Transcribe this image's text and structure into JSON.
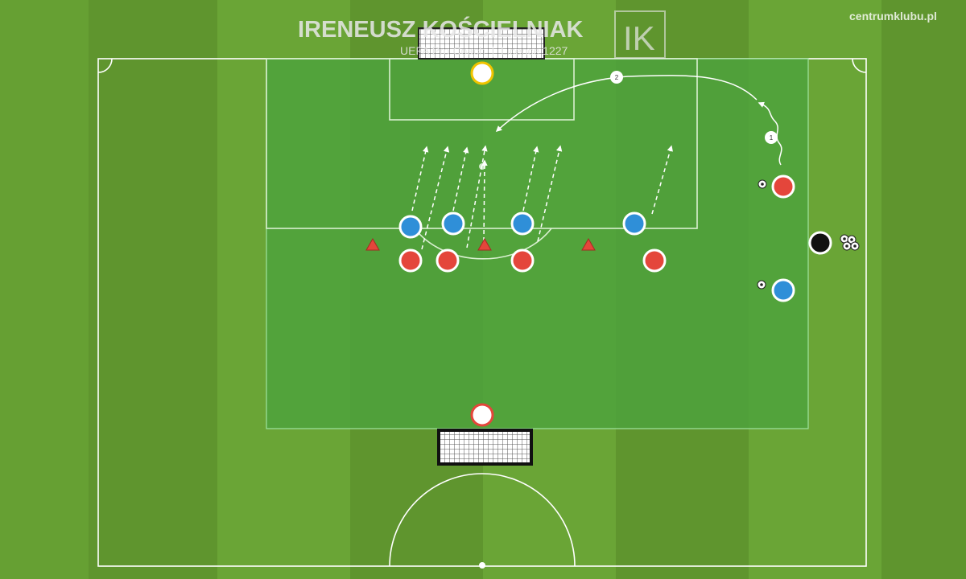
{
  "header": {
    "coach_name": "IRENEUSZ KOŚCIELNIAK",
    "coach_subtitle": "UEFA Pro Coach  |  Licence 1227",
    "logo_monogram": "IK",
    "site": "centrumklubu.pl"
  },
  "diagram": {
    "step_labels": [
      "1",
      "2"
    ],
    "colors": {
      "grass_light": "#6ea33a",
      "grass_dark": "#5f952e",
      "zone": "#4ea23c",
      "red_team": "#e4463b",
      "blue_team": "#2f8fd8",
      "goalkeeper_top_ring": "#f0c400",
      "goalkeeper_bottom_ring": "#e4463b",
      "server": "#111111",
      "cone": "#e4463b",
      "lines": "#ffffff"
    },
    "icons": [
      "soccer-ball-icon",
      "cone-icon",
      "goal-net-icon",
      "player-marker-icon"
    ]
  }
}
